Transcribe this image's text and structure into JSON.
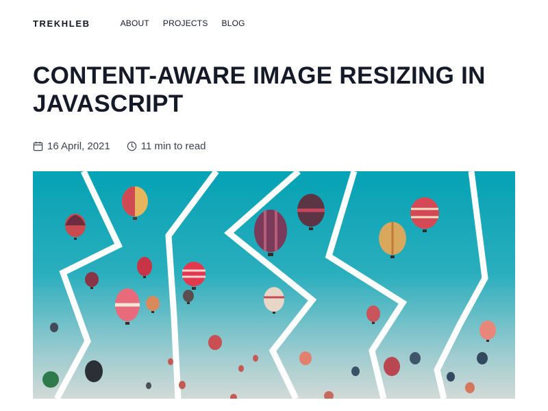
{
  "header": {
    "brand": "TREKHLEB",
    "nav": [
      "ABOUT",
      "PROJECTS",
      "BLOG"
    ]
  },
  "article": {
    "title": "CONTENT-AWARE IMAGE RESIZING IN JAVASCRIPT",
    "date": "16 April, 2021",
    "read_time": "11 min to read"
  },
  "icons": {
    "date": "calendar-icon",
    "read_time": "clock-icon"
  },
  "colors": {
    "title": "#141a27",
    "sky_top": "#0aa6b8",
    "sky_bottom": "#c9d6d4",
    "seam": "#ffffff"
  }
}
